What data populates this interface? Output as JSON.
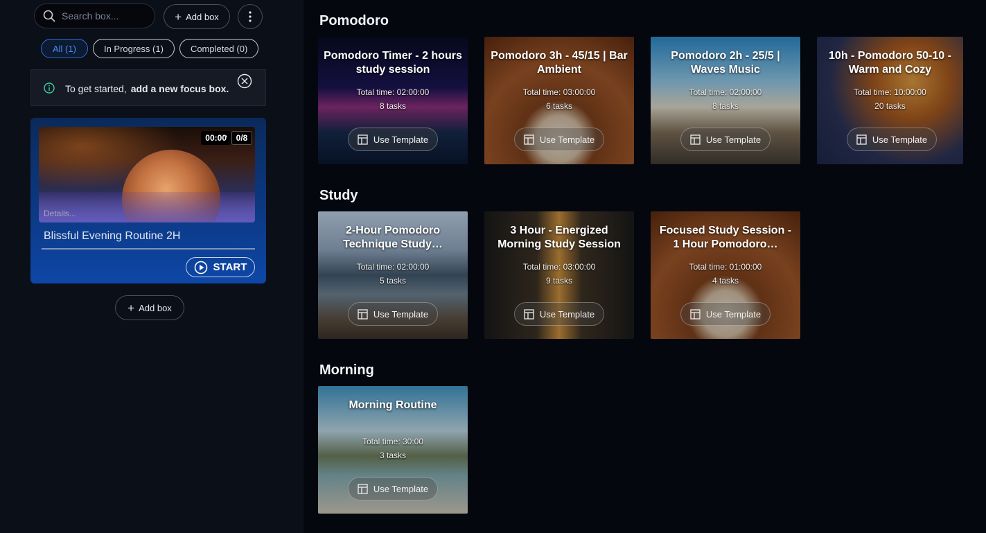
{
  "sidebar": {
    "search_placeholder": "Search box...",
    "add_box_label": "Add box",
    "filters": [
      {
        "label": "All (1)",
        "active": true
      },
      {
        "label": "In Progress (1)",
        "active": false
      },
      {
        "label": "Completed (0)",
        "active": false
      }
    ],
    "notice": {
      "prefix": "To get started,",
      "emphasis": "add a new focus box."
    },
    "focus_box": {
      "timer": "00:00",
      "progress": "0/8",
      "details_label": "Details...",
      "title": "Blissful Evening Routine 2H",
      "start_label": "START"
    },
    "add_box_bottom_label": "Add box"
  },
  "sections": [
    {
      "title": "Pomodoro",
      "templates": [
        {
          "title": "Pomodoro Timer - 2 hours study session",
          "time": "Total time: 02:00:00",
          "tasks": "8 tasks",
          "button": "Use Template"
        },
        {
          "title": "Pomodoro 3h - 45/15 | Bar Ambient",
          "time": "Total time: 03:00:00",
          "tasks": "6 tasks",
          "button": "Use Template"
        },
        {
          "title": "Pomodoro 2h - 25/5 | Waves Music",
          "time": "Total time: 02:00:00",
          "tasks": "8 tasks",
          "button": "Use Template"
        },
        {
          "title": "10h - Pomodoro 50-10 - Warm and Cozy",
          "time": "Total time: 10:00:00",
          "tasks": "20 tasks",
          "button": "Use Template"
        }
      ]
    },
    {
      "title": "Study",
      "templates": [
        {
          "title": "2-Hour Pomodoro Technique Study…",
          "time": "Total time: 02:00:00",
          "tasks": "5 tasks",
          "button": "Use Template"
        },
        {
          "title": "3 Hour - Energized Morning Study Session",
          "time": "Total time: 03:00:00",
          "tasks": "9 tasks",
          "button": "Use Template"
        },
        {
          "title": "Focused Study Session - 1 Hour Pomodoro…",
          "time": "Total time: 01:00:00",
          "tasks": "4 tasks",
          "button": "Use Template"
        }
      ]
    },
    {
      "title": "Morning",
      "templates": [
        {
          "title": "Morning Routine",
          "time": "Total time: 30:00",
          "tasks": "3 tasks",
          "button": "Use Template"
        }
      ]
    }
  ],
  "colors": {
    "accent": "#4d8fe8",
    "background": "#05070f",
    "sidebar": "#0b0f18",
    "focus_card": "#0c3a86"
  }
}
